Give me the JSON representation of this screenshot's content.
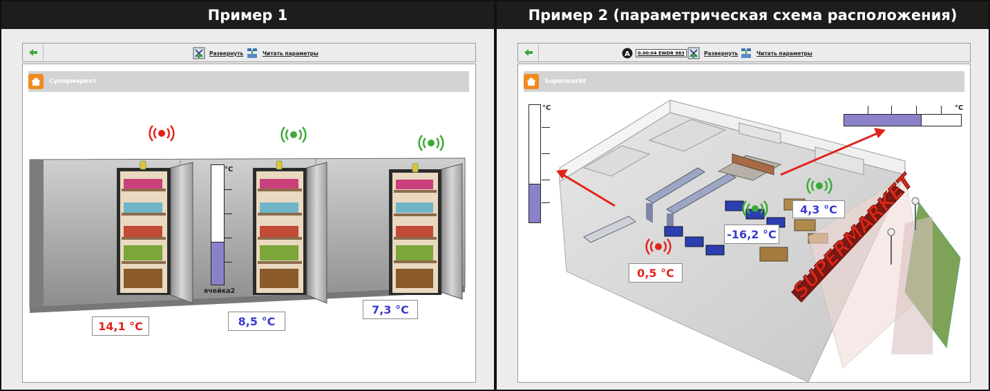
{
  "panel1": {
    "header": "Пример 1",
    "toolbar": {
      "expand_label": "Развернуть",
      "read_label": "Читать параметры"
    },
    "title": "Супермаркет",
    "thermometer": {
      "unit": "°C",
      "label": "ячейка2",
      "level": 0.36
    },
    "cells": [
      {
        "temp": "14,1 °C",
        "status": "alarm"
      },
      {
        "temp": "8,5 °C",
        "status": "ok"
      },
      {
        "temp": "7,3 °C",
        "status": "ok"
      }
    ]
  },
  "panel2": {
    "header": "Пример 2 (параметрическая схема расположения)",
    "toolbar": {
      "device_label": "0.00:04 EWDR 983",
      "expand_label": "Развернуть",
      "read_label": "Читать параметры"
    },
    "title": "Supermarkt",
    "thermo_vertical": {
      "unit": "°C",
      "level": 0.33
    },
    "thermo_horizontal": {
      "unit": "°C",
      "level": 0.66
    },
    "sensors": [
      {
        "temp": "0,5 °C",
        "status": "alarm"
      },
      {
        "temp": "-16,2 °C",
        "status": "ok"
      },
      {
        "temp": "4,3 °C",
        "status": "ok"
      }
    ],
    "store_sign": "SUPERMARKET"
  },
  "colors": {
    "alarm": "#e2231a",
    "ok": "#3aaa35",
    "value_blue": "#3a3ad0",
    "header_bg": "#1d1d1b",
    "accent": "#f28a1e"
  }
}
